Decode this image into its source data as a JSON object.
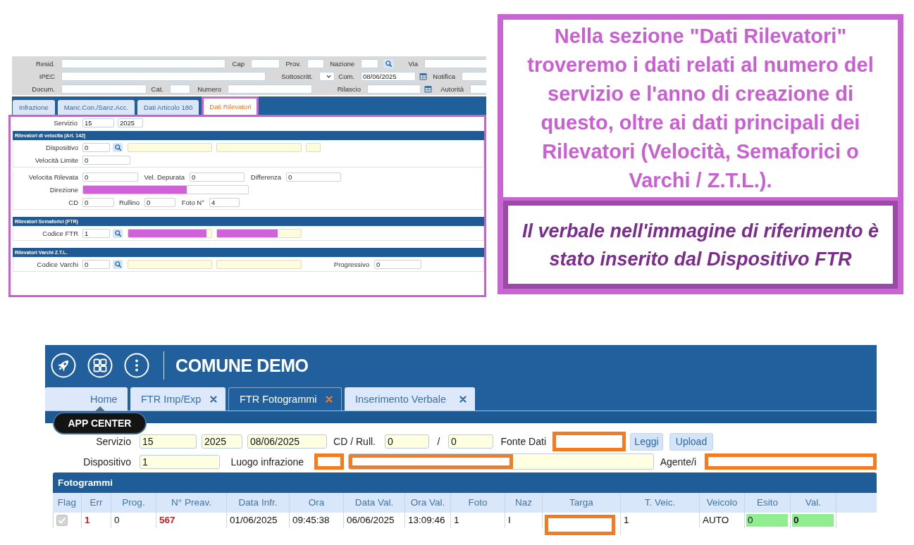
{
  "detail_form": {
    "top_rows": [
      [
        {
          "label": "Resid.",
          "kind": "text"
        },
        {
          "label": "Cap",
          "kind": "text"
        },
        {
          "label": "Prov.",
          "kind": "text"
        },
        {
          "label": "Nazione",
          "kind": "lookup"
        },
        {
          "label": "Via",
          "kind": "text"
        }
      ],
      [
        {
          "label": "IPEC",
          "kind": "text"
        },
        {
          "label": "Sottoscritt.",
          "kind": "select"
        },
        {
          "label": "Com.",
          "kind": "date",
          "value": "08/06/2025"
        },
        {
          "label": "Notifica",
          "kind": "text"
        }
      ],
      [
        {
          "label": "Docum.",
          "kind": "text"
        },
        {
          "label": "Cat.",
          "kind": "text"
        },
        {
          "label": "Numero",
          "kind": "text"
        },
        {
          "label": "Rilascio",
          "kind": "date"
        },
        {
          "label": "Autorità",
          "kind": "text"
        }
      ]
    ],
    "tabs": [
      {
        "label": "Infrazione",
        "selected": false,
        "highlighted": false
      },
      {
        "label": "Manc.Con./Sanz.Acc.",
        "selected": false,
        "highlighted": false
      },
      {
        "label": "Dati Articolo 180",
        "selected": false,
        "highlighted": false
      },
      {
        "label": "Dati Rilevatori",
        "selected": true,
        "highlighted": true
      }
    ],
    "service": {
      "label": "Servizio",
      "values": [
        "15",
        "2025"
      ]
    },
    "sections": [
      {
        "title": "Rilevatori di velocita (Art. 142)",
        "groups": [
          [
            {
              "label": "Dispositivo",
              "items": [
                {
                  "kind": "input",
                  "value": "0",
                  "masked": false
                },
                {
                  "kind": "lookup"
                },
                {
                  "kind": "info",
                  "masked": false
                },
                {
                  "kind": "info",
                  "masked": false
                },
                {
                  "kind": "info",
                  "masked": false
                }
              ]
            },
            {
              "label": "Velocità Limite",
              "items": [
                {
                  "kind": "input",
                  "value": "0",
                  "masked": false
                }
              ]
            }
          ],
          [
            {
              "label": "Velocita Rilevata",
              "items": [
                {
                  "kind": "input",
                  "value": "0",
                  "masked": false
                },
                {
                  "kind": "label",
                  "text": "Vel. Depurata"
                },
                {
                  "kind": "input",
                  "value": "0",
                  "masked": false
                },
                {
                  "kind": "label",
                  "text": "Differenza"
                },
                {
                  "kind": "input",
                  "value": "0",
                  "masked": false
                }
              ]
            },
            {
              "label": "Direzione",
              "items": [
                {
                  "kind": "input",
                  "masked": true
                }
              ]
            },
            {
              "label": "CD",
              "items": [
                {
                  "kind": "input",
                  "value": "0",
                  "masked": false
                },
                {
                  "kind": "label",
                  "text": "Rullino"
                },
                {
                  "kind": "input",
                  "value": "0",
                  "masked": false
                },
                {
                  "kind": "label",
                  "text": "Foto N°"
                },
                {
                  "kind": "input",
                  "value": "4",
                  "masked": false
                }
              ]
            }
          ]
        ]
      },
      {
        "title": "Rilevatori Semaforici (FTR)",
        "groups": [
          [
            {
              "label": "Codice FTR",
              "items": [
                {
                  "kind": "input",
                  "value": "1",
                  "masked": false
                },
                {
                  "kind": "lookup"
                },
                {
                  "kind": "info",
                  "masked": true
                },
                {
                  "kind": "info",
                  "masked": true
                }
              ]
            }
          ]
        ]
      },
      {
        "title": "Rilevatori Varchi Z.T.L.",
        "groups": [
          [
            {
              "label": "Codice Varchi",
              "items": [
                {
                  "kind": "input",
                  "value": "0",
                  "masked": false
                },
                {
                  "kind": "lookup"
                },
                {
                  "kind": "info",
                  "masked": false
                },
                {
                  "kind": "info",
                  "masked": false
                },
                {
                  "kind": "label",
                  "text": "Progressivo"
                },
                {
                  "kind": "input",
                  "value": "0",
                  "masked": false
                }
              ]
            }
          ]
        ]
      }
    ]
  },
  "annotation": {
    "text": "Nella sezione \"Dati Rilevatori\" troveremo i dati relati al numero del servizio e l'anno di creazione di questo, oltre ai dati principali dei Rilevatori (Velocità, Semaforici o Varchi / Z.T.L.).",
    "note": "Il verbale nell'immagine di riferimento è stato inserito dal Dispositivo FTR"
  },
  "app": {
    "title": "COMUNE DEMO",
    "tooltip": "APP CENTER",
    "tabs": [
      {
        "label": "Home",
        "selected": false,
        "closable": false
      },
      {
        "label": "FTR Imp/Exp",
        "selected": false,
        "closable": true
      },
      {
        "label": "FTR Fotogrammi",
        "selected": true,
        "closable": true
      },
      {
        "label": "Inserimento Verbale",
        "selected": false,
        "closable": true
      }
    ],
    "form_rows": [
      [
        {
          "kind": "label",
          "text": "Servizio"
        },
        {
          "kind": "input",
          "value": "15",
          "masked": false
        },
        {
          "kind": "input",
          "value": "2025",
          "masked": false
        },
        {
          "kind": "input",
          "value": "08/06/2025",
          "masked": false
        },
        {
          "kind": "label",
          "text": "CD / Rull."
        },
        {
          "kind": "input",
          "value": "0",
          "masked": false
        },
        {
          "kind": "label",
          "text": "/"
        },
        {
          "kind": "input",
          "value": "0",
          "masked": false
        },
        {
          "kind": "label",
          "text": "Fonte Dati"
        },
        {
          "kind": "input",
          "masked": true
        },
        {
          "kind": "button",
          "text": "Leggi"
        },
        {
          "kind": "button",
          "text": "Upload"
        }
      ],
      [
        {
          "kind": "label",
          "text": "Dispositivo"
        },
        {
          "kind": "input",
          "value": "1",
          "masked": false
        },
        {
          "kind": "label",
          "text": "Luogo infrazione"
        },
        {
          "kind": "input",
          "masked": true
        },
        {
          "kind": "input",
          "masked": true
        },
        {
          "kind": "label",
          "text": "Agente/i"
        },
        {
          "kind": "input",
          "masked": true
        }
      ]
    ],
    "table": {
      "title": "Fotogrammi",
      "columns": [
        "Flag",
        "Err",
        "Prog.",
        "N° Preav.",
        "Data Infr.",
        "Ora",
        "Data Val.",
        "Ora Val.",
        "Foto",
        "Naz",
        "Targa",
        "T. Veic.",
        "Veicolo",
        "Esito",
        "Val."
      ],
      "rows": [
        {
          "cells": [
            {
              "kind": "checkbox",
              "checked": true,
              "disabled": true
            },
            {
              "kind": "error",
              "text": "1"
            },
            {
              "kind": "plain",
              "text": "0"
            },
            {
              "kind": "error",
              "text": "567"
            },
            {
              "kind": "plain",
              "text": "01/06/2025"
            },
            {
              "kind": "plain",
              "text": "09:45:38"
            },
            {
              "kind": "plain",
              "text": "06/06/2025"
            },
            {
              "kind": "plain",
              "text": "13:09:46"
            },
            {
              "kind": "plain",
              "text": "1"
            },
            {
              "kind": "plain",
              "text": "I"
            },
            {
              "kind": "masked"
            },
            {
              "kind": "plain",
              "text": "1"
            },
            {
              "kind": "plain",
              "text": "AUTO"
            },
            {
              "kind": "ok",
              "text": "0"
            },
            {
              "kind": "ok-strong",
              "text": "0"
            }
          ]
        }
      ]
    }
  }
}
